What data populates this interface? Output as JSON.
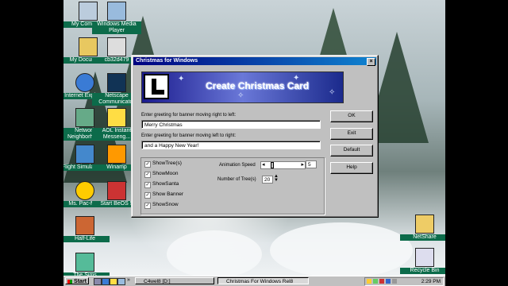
{
  "desktop": {
    "icons": [
      {
        "label": "My Computer"
      },
      {
        "label": "Windows Media Player"
      },
      {
        "label": "My Documents"
      },
      {
        "label": "cb32d479"
      },
      {
        "label": "Internet Explorer"
      },
      {
        "label": "Netscape Communicator"
      },
      {
        "label": "Network Neighborhood"
      },
      {
        "label": "AOL Instant Messeng..."
      },
      {
        "label": "Flight Simulator 98"
      },
      {
        "label": "Winamp"
      },
      {
        "label": "Ms. Pac-Man"
      },
      {
        "label": "Start BeOS 5"
      },
      {
        "label": "Half-Life"
      },
      {
        "label": "The Sims"
      },
      {
        "label": "NetShare"
      },
      {
        "label": "Recycle Bin"
      }
    ]
  },
  "dialog": {
    "title": "Christmas for Windows",
    "banner_text": "Create Christmas Card",
    "greeting1_label": "Enter greeting for banner moving right to left:",
    "greeting1_value": "Merry Christmas",
    "greeting2_label": "Enter greeting for banner moving left to right:",
    "greeting2_value": "and a Happy New Year!",
    "buttons": {
      "ok": "OK",
      "exit": "Exit",
      "default": "Default",
      "help": "Help"
    },
    "options": [
      {
        "label": "ShowTree(s)",
        "checked": true
      },
      {
        "label": "ShowMoon",
        "checked": true
      },
      {
        "label": "ShowSanta",
        "checked": true
      },
      {
        "label": "Show Banner",
        "checked": true
      },
      {
        "label": "ShowSnow",
        "checked": true
      }
    ],
    "animation_speed_label": "Animation Speed",
    "animation_speed_value": "5",
    "trees_label": "Number of Tree(s)",
    "trees_value": "20"
  },
  "taskbar": {
    "start_label": "Start",
    "tasks": [
      {
        "label": "C4wel8 [D:]"
      },
      {
        "label": "Christmas For Windows Rel8"
      }
    ],
    "clock": "2:29 PM"
  }
}
